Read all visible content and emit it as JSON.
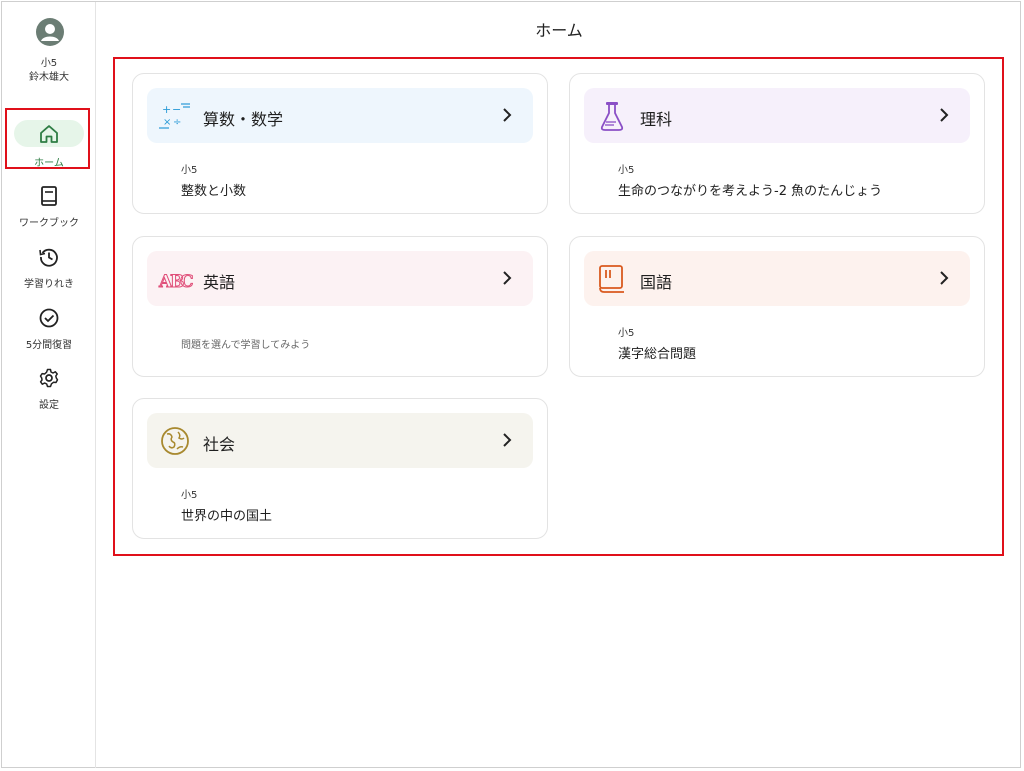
{
  "user": {
    "grade": "小5",
    "name": "鈴木雄大"
  },
  "nav": {
    "home": "ホーム",
    "workbook": "ワークブック",
    "history": "学習りれき",
    "review": "5分間復習",
    "settings": "設定"
  },
  "page": {
    "title": "ホーム"
  },
  "subjects": [
    {
      "name": "算数・数学",
      "grade": "小5",
      "unit": "整数と小数",
      "icon": "math-symbols-icon"
    },
    {
      "name": "理科",
      "grade": "小5",
      "unit": "生命のつながりを考えよう-2 魚のたんじょう",
      "icon": "flask-icon"
    },
    {
      "name": "英語",
      "hint": "問題を選んで学習してみよう",
      "icon": "abc-letters-icon"
    },
    {
      "name": "国語",
      "grade": "小5",
      "unit": "漢字総合問題",
      "icon": "book-icon"
    },
    {
      "name": "社会",
      "grade": "小5",
      "unit": "世界の中の国土",
      "icon": "globe-icon"
    }
  ],
  "colors": {
    "accent_green": "#2e7d44",
    "highlight_red": "#e0101a",
    "math_bg": "#eef6fd",
    "science_bg": "#f6f0fb",
    "english_bg": "#fcf2f4",
    "japanese_bg": "#fdf2ee",
    "social_bg": "#f5f4ee"
  }
}
